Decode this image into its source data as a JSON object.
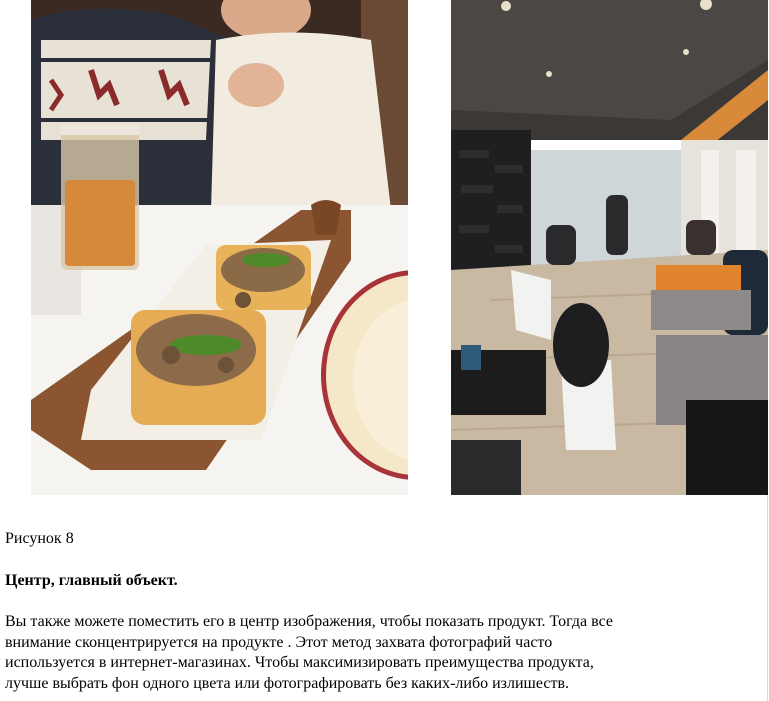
{
  "figure": {
    "caption": "Рисунок 8",
    "left_photo_alt": "food-photo-bruschetta",
    "right_photo_alt": "cafe-interior-photo"
  },
  "section": {
    "heading": "Центр, главный объект.",
    "paragraph_lines": [
      "Вы также можете поместить его в центр изображения, чтобы показать продукт. Тогда все",
      "внимание сконцентрируется на продукте . Этот метод захвата фотографий часто",
      "используется в интернет-магазинах. Чтобы максимизировать преимущества продукта,",
      "лучше выбрать фон одного цвета или фотографировать без каких-либо излишеств."
    ]
  }
}
